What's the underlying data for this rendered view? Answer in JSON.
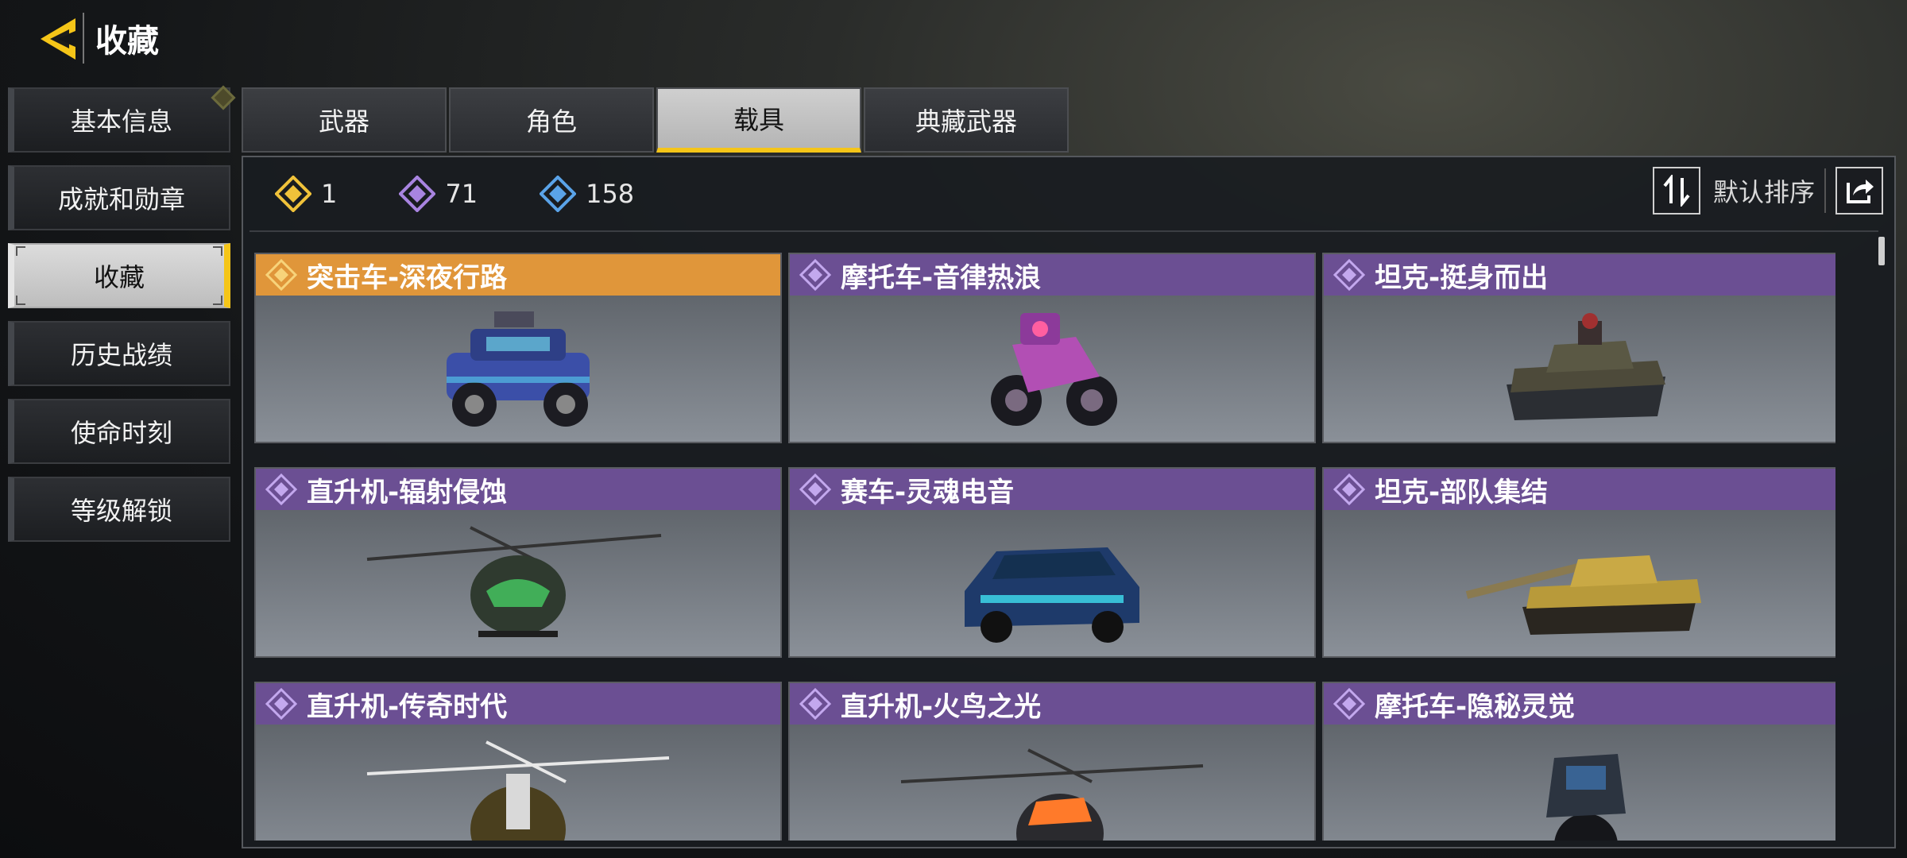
{
  "header": {
    "title": "收藏",
    "back_icon": "chevron-left-icon"
  },
  "side_menu": {
    "items": [
      {
        "label": "基本信息",
        "active": false
      },
      {
        "label": "成就和勋章",
        "active": false
      },
      {
        "label": "收藏",
        "active": true
      },
      {
        "label": "历史战绩",
        "active": false
      },
      {
        "label": "使命时刻",
        "active": false
      },
      {
        "label": "等级解锁",
        "active": false
      }
    ]
  },
  "tabs": [
    {
      "label": "武器",
      "active": false
    },
    {
      "label": "角色",
      "active": false
    },
    {
      "label": "载具",
      "active": true
    },
    {
      "label": "典藏武器",
      "active": false
    }
  ],
  "stats": [
    {
      "value": "1",
      "color": "#f0c23a",
      "icon": "legendary-gem-icon"
    },
    {
      "value": "71",
      "color": "#a884e0",
      "icon": "epic-gem-icon"
    },
    {
      "value": "158",
      "color": "#5aa3e8",
      "icon": "rare-gem-icon"
    }
  ],
  "sort": {
    "label": "默认排序",
    "sort_icon": "sort-toggle-icon",
    "share_icon": "share-icon"
  },
  "vehicles": [
    {
      "name": "突击车-深夜行路",
      "rarity": "legendary",
      "header_color": "#e0963a",
      "type": "assault-vehicle"
    },
    {
      "name": "摩托车-音律热浪",
      "rarity": "epic",
      "header_color": "#6b4f93",
      "type": "motorcycle"
    },
    {
      "name": "坦克-挺身而出",
      "rarity": "epic",
      "header_color": "#6b4f93",
      "type": "tank"
    },
    {
      "name": "直升机-辐射侵蚀",
      "rarity": "epic",
      "header_color": "#6b4f93",
      "type": "helicopter"
    },
    {
      "name": "赛车-灵魂电音",
      "rarity": "epic",
      "header_color": "#6b4f93",
      "type": "race-car"
    },
    {
      "name": "坦克-部队集结",
      "rarity": "epic",
      "header_color": "#6b4f93",
      "type": "tank-gold"
    },
    {
      "name": "直升机-传奇时代",
      "rarity": "epic",
      "header_color": "#6b4f93",
      "type": "helicopter-gold"
    },
    {
      "name": "直升机-火鸟之光",
      "rarity": "epic",
      "header_color": "#6b4f93",
      "type": "helicopter-orange"
    },
    {
      "name": "摩托车-隐秘灵觉",
      "rarity": "epic",
      "header_color": "#6b4f93",
      "type": "motorcycle-dark"
    }
  ]
}
